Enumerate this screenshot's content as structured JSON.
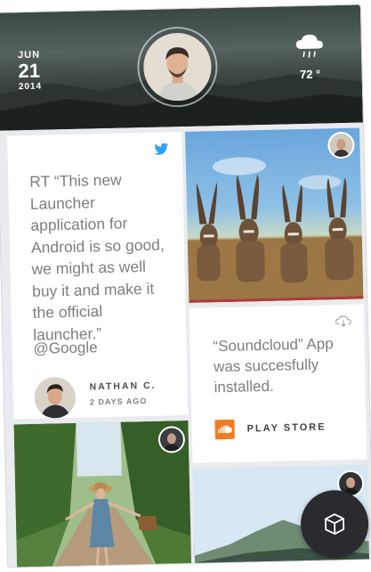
{
  "header": {
    "date": {
      "month": "JUN",
      "day": "21",
      "year": "2014"
    },
    "profile_photo": "man-portrait",
    "weather": {
      "icon": "rain-cloud-icon",
      "temperature": "72 °"
    }
  },
  "tweet_card": {
    "icon": "twitter-bird-icon",
    "text": "RT “This new Launcher application for Android is so good, we might as well buy it and make it the official launcher.”",
    "handle": "@Google",
    "author_name": "NATHAN C.",
    "time_ago": "2 DAYS AGO"
  },
  "photo_cards": [
    {
      "subject": "antelopes-in-savanna"
    },
    {
      "subject": "woman-with-basket-on-forest-road"
    },
    {
      "subject": "mountain-landscape"
    }
  ],
  "notification_card": {
    "icon": "cloud-download-icon",
    "text": "“Soundcloud” App was succesfully installed.",
    "source_label": "PLAY STORE",
    "source_icon": "soundcloud-logo"
  },
  "fab": {
    "icon": "cube-icon"
  },
  "colors": {
    "twitter_blue": "#2aa3ef",
    "text_gray": "#7b7e82",
    "soundcloud_orange": "#f27b21",
    "fab_dark": "#2a2b2e",
    "accent_red": "#b23a3a"
  }
}
